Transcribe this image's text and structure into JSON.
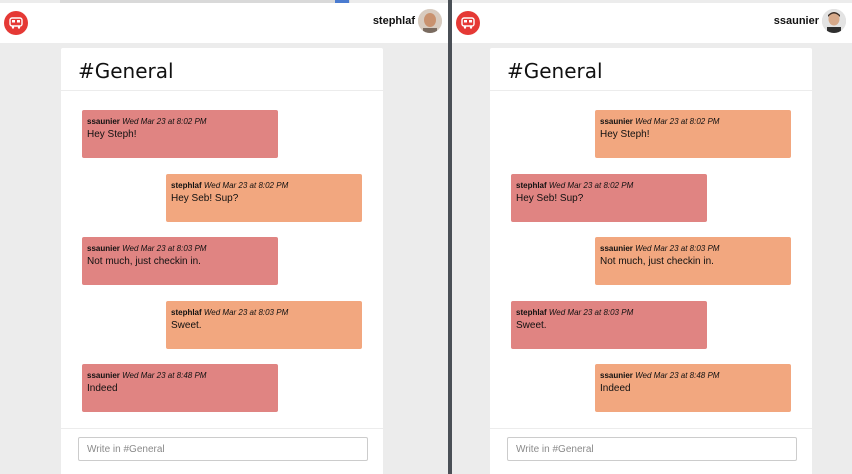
{
  "panes": {
    "left": {
      "current_user": "stephlaf",
      "channel_title": "#General",
      "composer_placeholder": "Write in #General",
      "messages": [
        {
          "author": "ssaunier",
          "time": "Wed Mar 23 at 8:02 PM",
          "text": "Hey Steph!",
          "own": false
        },
        {
          "author": "stephlaf",
          "time": "Wed Mar 23 at 8:02 PM",
          "text": "Hey Seb! Sup?",
          "own": true
        },
        {
          "author": "ssaunier",
          "time": "Wed Mar 23 at 8:03 PM",
          "text": "Not much, just checkin in.",
          "own": false
        },
        {
          "author": "stephlaf",
          "time": "Wed Mar 23 at 8:03 PM",
          "text": "Sweet.",
          "own": true
        },
        {
          "author": "ssaunier",
          "time": "Wed Mar 23 at 8:48 PM",
          "text": "Indeed",
          "own": false
        }
      ]
    },
    "right": {
      "current_user": "ssaunier",
      "channel_title": "#General",
      "composer_placeholder": "Write in #General",
      "messages": [
        {
          "author": "ssaunier",
          "time": "Wed Mar 23 at 8:02 PM",
          "text": "Hey Steph!",
          "own": true
        },
        {
          "author": "stephlaf",
          "time": "Wed Mar 23 at 8:02 PM",
          "text": "Hey Seb! Sup?",
          "own": false
        },
        {
          "author": "ssaunier",
          "time": "Wed Mar 23 at 8:03 PM",
          "text": "Not much, just checkin in.",
          "own": true
        },
        {
          "author": "stephlaf",
          "time": "Wed Mar 23 at 8:03 PM",
          "text": "Sweet.",
          "own": false
        },
        {
          "author": "ssaunier",
          "time": "Wed Mar 23 at 8:48 PM",
          "text": "Indeed",
          "own": true
        }
      ]
    }
  },
  "icons": {
    "logo": "bus-icon",
    "avatar": "user-avatar"
  },
  "colors": {
    "logo_bg": "#e53935",
    "own_message": "#f2a77f",
    "other_message": "#e08482"
  }
}
